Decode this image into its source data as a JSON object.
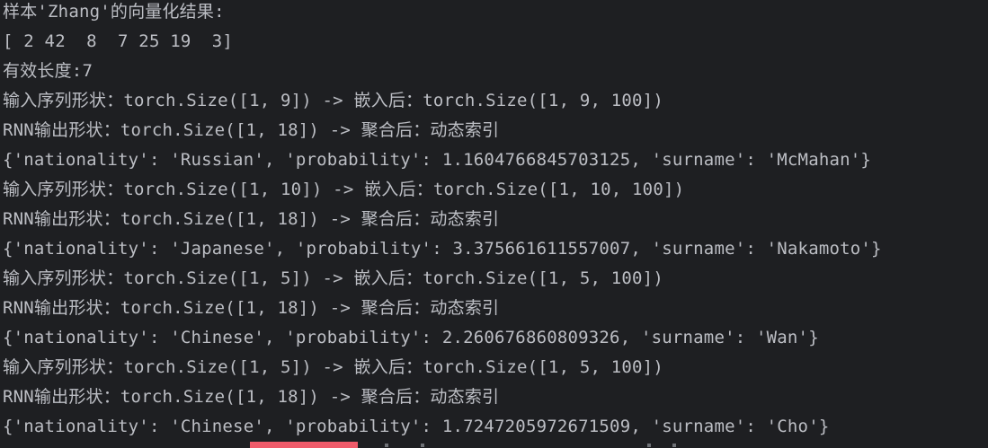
{
  "console": {
    "lines": [
      "样本'Zhang'的向量化结果:",
      "[ 2 42  8  7 25 19  3]",
      "有效长度:7",
      "输入序列形状：torch.Size([1, 9]) -> 嵌入后：torch.Size([1, 9, 100])",
      "RNN输出形状：torch.Size([1, 18]) -> 聚合后：动态索引",
      "{'nationality': 'Russian', 'probability': 1.1604766845703125, 'surname': 'McMahan'}",
      "输入序列形状：torch.Size([1, 10]) -> 嵌入后：torch.Size([1, 10, 100])",
      "RNN输出形状：torch.Size([1, 18]) -> 聚合后：动态索引",
      "{'nationality': 'Japanese', 'probability': 3.375661611557007, 'surname': 'Nakamoto'}",
      "输入序列形状：torch.Size([1, 5]) -> 嵌入后：torch.Size([1, 5, 100])",
      "RNN输出形状：torch.Size([1, 18]) -> 聚合后：动态索引",
      "{'nationality': 'Chinese', 'probability': 2.260676860809326, 'surname': 'Wan'}",
      "输入序列形状：torch.Size([1, 5]) -> 嵌入后：torch.Size([1, 5, 100])",
      "RNN输出形状：torch.Size([1, 18]) -> 聚合后：动态索引",
      "{'nationality': 'Chinese', 'probability': 1.7247205972671509, 'surname': 'Cho'}"
    ]
  },
  "colors": {
    "background": "#1e1f22",
    "text": "#bcbec4",
    "highlight": "#ef5b6a"
  }
}
